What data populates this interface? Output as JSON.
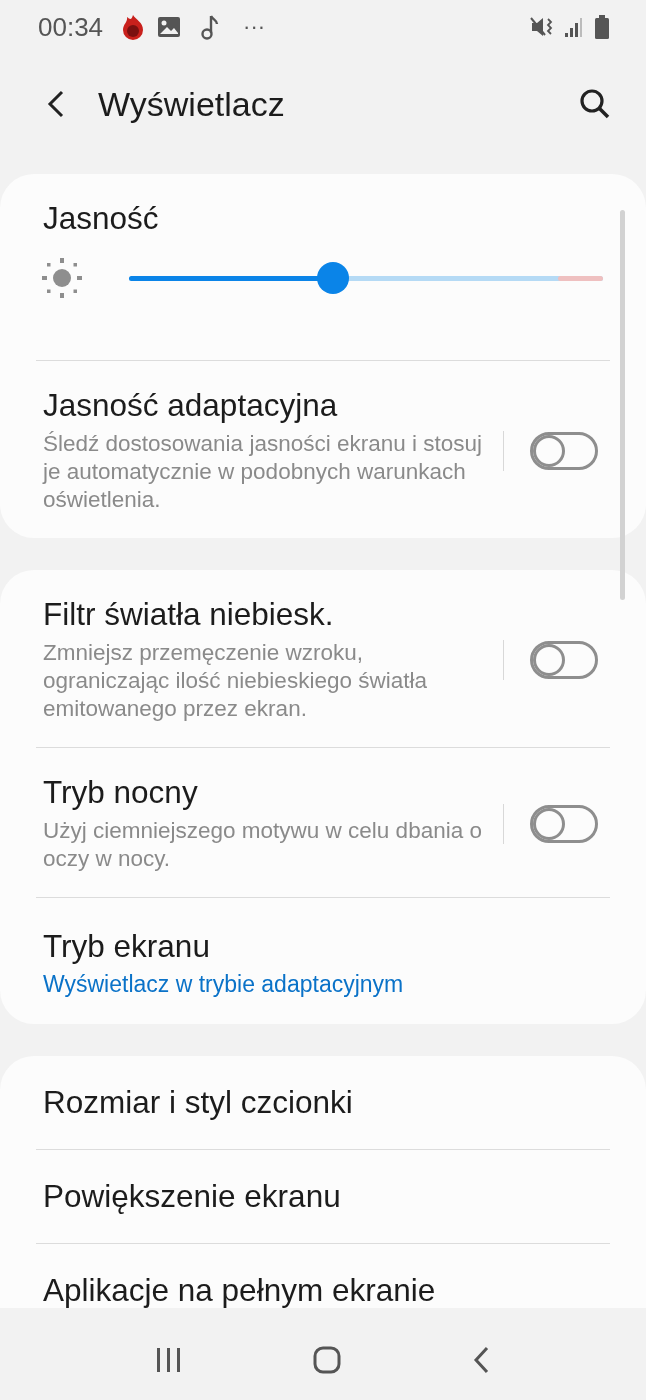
{
  "status_bar": {
    "time": "00:34",
    "more": "···"
  },
  "header": {
    "title": "Wyświetlacz"
  },
  "sections": [
    {
      "rows": [
        {
          "kind": "slider",
          "title": "Jasność",
          "level": 0.43
        },
        {
          "kind": "toggle",
          "title": "Jasność adaptacyjna",
          "subtitle": "Śledź dostosowania jasności ekranu i stosuj je automatycznie w podobnych warunkach oświetlenia.",
          "on": false
        }
      ]
    },
    {
      "rows": [
        {
          "kind": "toggle",
          "title": "Filtr światła niebiesk.",
          "subtitle": "Zmniejsz przemęczenie wzroku, ograniczając ilość niebieskiego światła emitowanego przez ekran.",
          "on": false
        },
        {
          "kind": "toggle",
          "title": "Tryb nocny",
          "subtitle": "Użyj ciemniejszego motywu w celu dbania o oczy w nocy.",
          "on": false
        },
        {
          "kind": "link",
          "title": "Tryb ekranu",
          "value": "Wyświetlacz w trybie adaptacyjnym"
        }
      ]
    },
    {
      "rows": [
        {
          "kind": "plain",
          "title": "Rozmiar i styl czcionki"
        },
        {
          "kind": "plain",
          "title": "Powiększenie ekranu"
        },
        {
          "kind": "plain",
          "title": "Aplikacje na pełnym ekranie"
        }
      ]
    }
  ]
}
